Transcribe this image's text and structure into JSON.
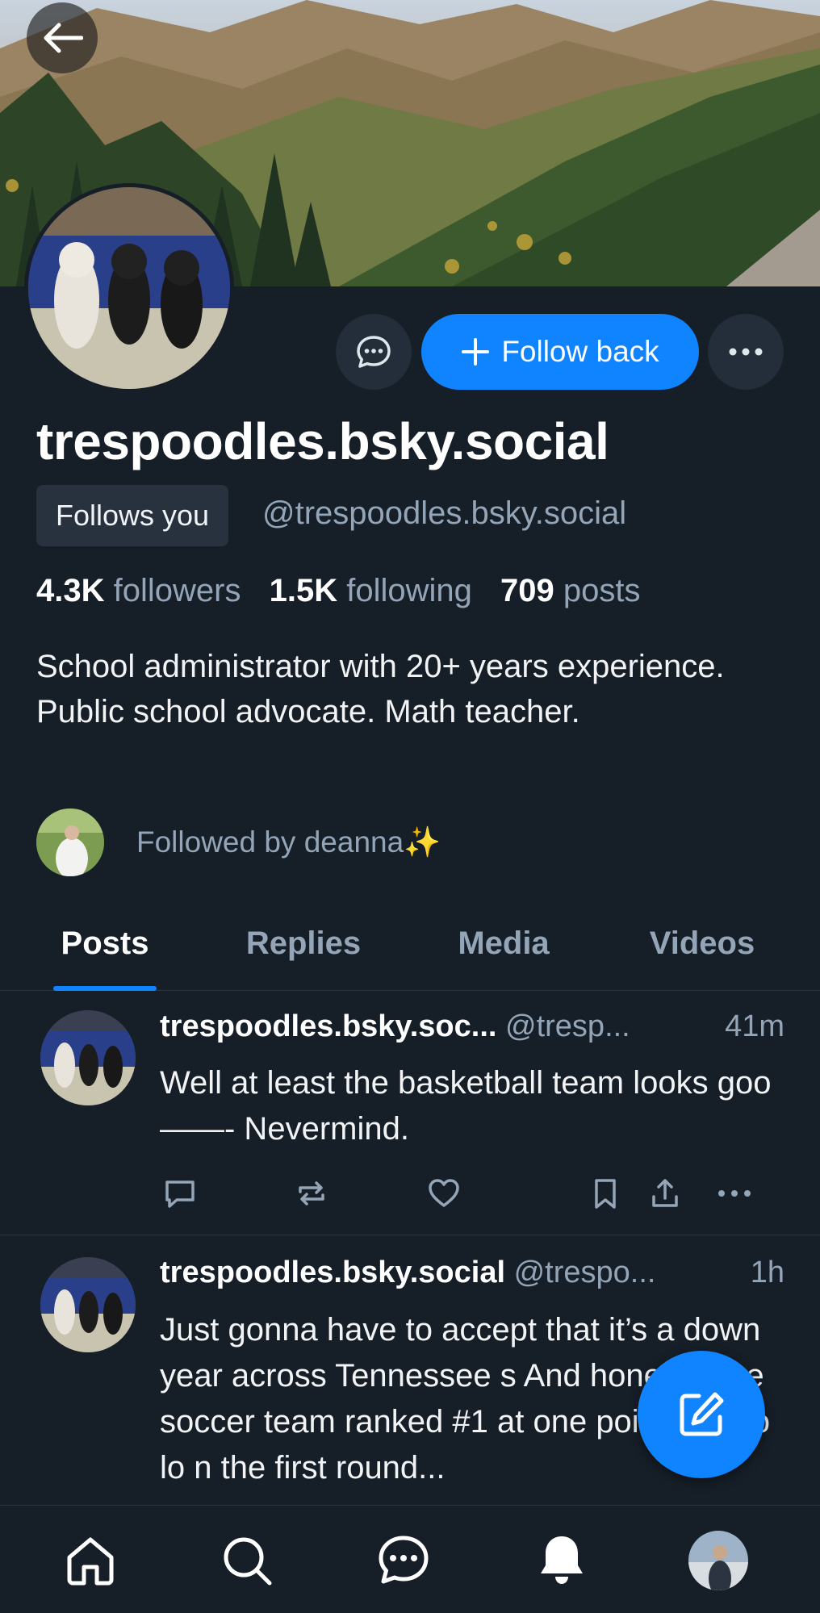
{
  "profile": {
    "display_name": "trespoodles.bsky.social",
    "follows_you_badge": "Follows you",
    "handle": "@trespoodles.bsky.social",
    "followers_count": "4.3K",
    "followers_label": "followers",
    "following_count": "1.5K",
    "following_label": "following",
    "posts_count": "709",
    "posts_label": "posts",
    "bio": "School administrator with 20+ years experience. Public school advocate. Math teacher.",
    "followed_by": "Followed by deanna✨"
  },
  "actions": {
    "follow_back_label": "Follow back",
    "message_icon": "chat-bubble-icon",
    "more_icon": "ellipsis-icon"
  },
  "tabs": [
    {
      "label": "Posts",
      "active": true
    },
    {
      "label": "Replies",
      "active": false
    },
    {
      "label": "Media",
      "active": false
    },
    {
      "label": "Videos",
      "active": false
    }
  ],
  "posts": [
    {
      "name": "trespoodles.bsky.soc...",
      "handle": "@tresp...",
      "time": "41m",
      "text": "Well at least the basketball team looks goo——- Nevermind."
    },
    {
      "name": "trespoodles.bsky.social",
      "handle": "@trespo...",
      "time": "1h",
      "text": "Just gonna have to accept that it’s a down year across Tennessee s And honestly the soccer team ranked #1 at one point only to lo n the first round..."
    }
  ],
  "colors": {
    "background": "#161e27",
    "accent": "#1083fe",
    "muted_text": "#93a5b7",
    "badge_bg": "#28323f"
  },
  "nav": [
    "home-icon",
    "search-icon",
    "chat-icon",
    "notifications-icon",
    "profile-avatar"
  ]
}
